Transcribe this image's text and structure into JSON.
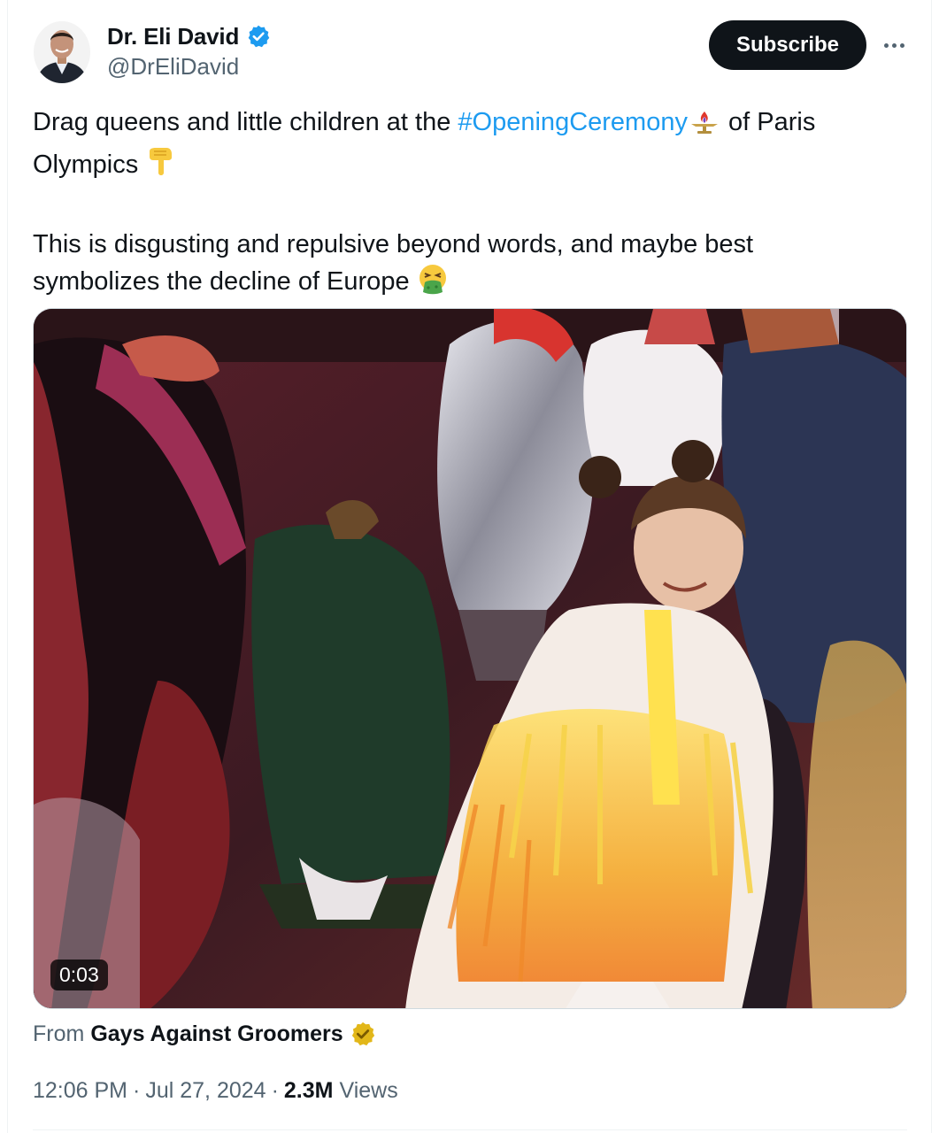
{
  "author": {
    "display_name": "Dr. Eli David",
    "handle": "@DrEliDavid",
    "verified": true,
    "badge_color": "#1d9bf0"
  },
  "header": {
    "subscribe_label": "Subscribe",
    "more_icon": "ellipsis-icon"
  },
  "tweet": {
    "line1_before": "Drag queens and little children at the ",
    "hashtag": "#OpeningCeremony",
    "line1_after": " of Paris",
    "line2": "Olympics",
    "paragraph2_line1": "This is disgusting and repulsive beyond words, and maybe best",
    "paragraph2_line2": "symbolizes the decline of Europe",
    "emojis": [
      "olympic-torch-emoji",
      "pointing-down-emoji",
      "vomiting-face-emoji"
    ]
  },
  "media": {
    "duration": "0:03",
    "type": "video"
  },
  "source": {
    "from_label": "From",
    "name": "Gays Against Groomers",
    "badge_color": "#e2b719"
  },
  "meta": {
    "time": "12:06 PM",
    "date": "Jul 27, 2024",
    "separator": "·",
    "views_count": "2.3M",
    "views_label": "Views"
  },
  "colors": {
    "link": "#1d9bf0",
    "text": "#0f1419",
    "muted": "#536471",
    "button_bg": "#0f1419"
  }
}
